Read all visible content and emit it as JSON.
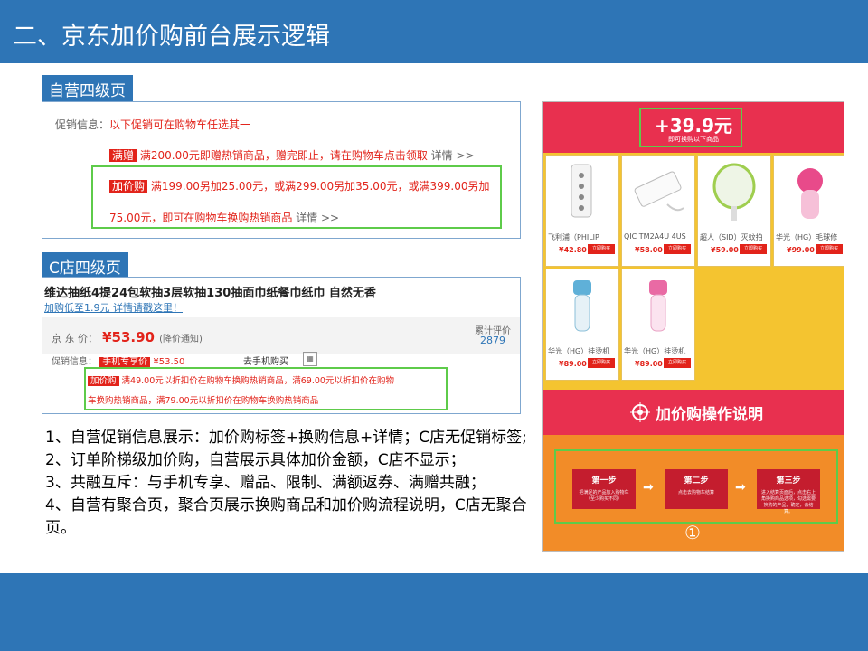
{
  "title": "二、京东加价购前台展示逻辑",
  "self_section": {
    "label": "自营四级页",
    "promo_label": "促销信息：",
    "promo_text": "以下促销可在购物车任选其一",
    "gift_tag": "满赠",
    "gift_text": "满200.00元即赠热销商品，赠完即止，请在购物车点击领取",
    "gift_details": "详情 >>",
    "jjg_tag": "加价购",
    "jjg_line1": "满199.00另加25.00元，或满299.00另加35.00元，或满399.00另加",
    "jjg_line2": "75.00元，即可在购物车换购热销商品",
    "jjg_details": "详情 >>"
  },
  "c_section": {
    "label": "C店四级页",
    "product_title": "维达抽纸4提24包软抽3层软抽130抽面巾纸餐巾纸巾 自然无香",
    "subtitle": "加购低至1.9元 详情请戳这里！",
    "price_label": "京 东 价：",
    "price": "¥53.90",
    "price_notice": "(降价通知)",
    "review_label": "累计评价",
    "review_count": "2879",
    "promo_label": "促销信息：",
    "mobile_tag": "手机专享价",
    "mobile_price": "¥53.50",
    "mobile_link": "去手机购买",
    "jjg_tag": "加价购",
    "jjg_line1": "满49.00元以折扣价在购物车换购热销商品，满69.00元以折扣价在购物",
    "jjg_line2": "车换购热销商品，满79.00元以折扣价在购物车换购热销商品"
  },
  "bullets": [
    "1、自营促销信息展示：加价购标签+换购信息+详情；C店无促销标签;",
    "2、订单阶梯级加价购，自营展示具体加价金额，C店不显示；",
    "3、共融互斥：与手机专享、赠品、限制、满额返券、满赠共融；",
    "4、自营有聚合页，聚合页展示换购商品和加价购流程说明，C店无聚合页。"
  ],
  "phone": {
    "price": "+39.9元",
    "price_sub": "即可换购以下商品",
    "products": [
      {
        "name": "飞利浦（PHILIP",
        "price": "¥42.80",
        "btn": "立即购买"
      },
      {
        "name": "QIC TM2A4U 4US",
        "price": "¥58.00",
        "btn": "立即购买"
      },
      {
        "name": "超人（SID）灭蚊拍",
        "price": "¥59.00",
        "btn": "立即购买"
      },
      {
        "name": "华光（HG）毛球修",
        "price": "¥99.00",
        "btn": "立即购买"
      },
      {
        "name": "华光（HG）挂烫机",
        "price": "¥89.00",
        "btn": "立即购买"
      },
      {
        "name": "华光（HG）挂烫机",
        "price": "¥89.00",
        "btn": "立即购买"
      }
    ],
    "band_title": "加价购操作说明",
    "steps": [
      {
        "title": "第一步",
        "desc": "把满足的产品放入购物车（至少购买不同）"
      },
      {
        "title": "第二步",
        "desc": "点击去购物车结算"
      },
      {
        "title": "第三步",
        "desc": "进入结算页面后，点击右上角换购商品选项，勾选需要换购的产品，确定，去结算。"
      }
    ],
    "step_number": "①"
  },
  "colors": {
    "brand_blue": "#2e75b6",
    "jd_red": "#e2231a",
    "highlight_green": "#5ecb4a",
    "phone_red": "#e8304f",
    "phone_yellow": "#f4c430",
    "phone_orange": "#f28c28"
  }
}
